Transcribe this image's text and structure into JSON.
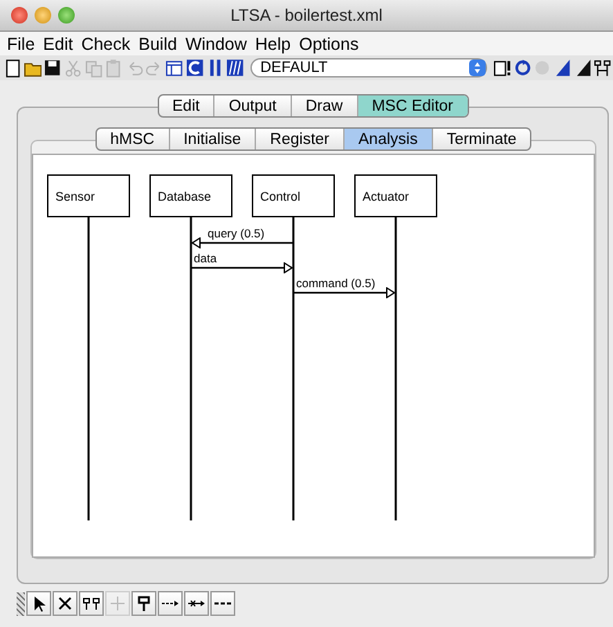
{
  "window": {
    "title": "LTSA - boilertest.xml"
  },
  "menu": [
    "File",
    "Edit",
    "Check",
    "Build",
    "Window",
    "Help",
    "Options"
  ],
  "toolbar": {
    "left": [
      {
        "kind": "new",
        "disabled": false
      },
      {
        "kind": "open",
        "disabled": false
      },
      {
        "kind": "save",
        "disabled": false
      },
      {
        "kind": "cut",
        "disabled": true
      },
      {
        "kind": "copy",
        "disabled": true
      },
      {
        "kind": "paste",
        "disabled": true
      },
      {
        "kind": "undo",
        "disabled": true
      },
      {
        "kind": "redo",
        "disabled": true
      },
      {
        "kind": "window",
        "disabled": false
      },
      {
        "kind": "compile",
        "disabled": false
      },
      {
        "kind": "parallel",
        "disabled": false
      },
      {
        "kind": "minimise",
        "disabled": false
      }
    ],
    "dropdown": {
      "value": "DEFAULT"
    },
    "right": [
      {
        "kind": "safety",
        "disabled": false
      },
      {
        "kind": "progress",
        "disabled": false
      },
      {
        "kind": "stop",
        "disabled": true
      },
      {
        "kind": "alphabet",
        "disabled": false
      },
      {
        "kind": "trace",
        "disabled": false
      },
      {
        "kind": "draw",
        "disabled": false
      }
    ]
  },
  "tabs": [
    {
      "label": "Edit",
      "selected": false
    },
    {
      "label": "Output",
      "selected": false
    },
    {
      "label": "Draw",
      "selected": false
    },
    {
      "label": "MSC Editor",
      "selected": true
    }
  ],
  "subtabs": [
    {
      "label": "hMSC",
      "selected": false
    },
    {
      "label": "Initialise",
      "selected": false
    },
    {
      "label": "Register",
      "selected": false
    },
    {
      "label": "Analysis",
      "selected": true
    },
    {
      "label": "Terminate",
      "selected": false
    }
  ],
  "diagram": {
    "instances": [
      "Sensor",
      "Database",
      "Control",
      "Actuator"
    ],
    "messages": [
      {
        "label": "query (0.5)",
        "kind": "leftward"
      },
      {
        "label": "data",
        "kind": "rightward"
      },
      {
        "label": "command (0.5)",
        "kind": "rightward"
      }
    ]
  },
  "palette": [
    {
      "kind": "select",
      "disabled": false
    },
    {
      "kind": "delete",
      "disabled": false
    },
    {
      "kind": "instances",
      "disabled": false
    },
    {
      "kind": "condition",
      "disabled": true
    },
    {
      "kind": "instance",
      "disabled": false
    },
    {
      "kind": "message",
      "disabled": false
    },
    {
      "kind": "lost",
      "disabled": false
    },
    {
      "kind": "separator",
      "disabled": false
    }
  ]
}
